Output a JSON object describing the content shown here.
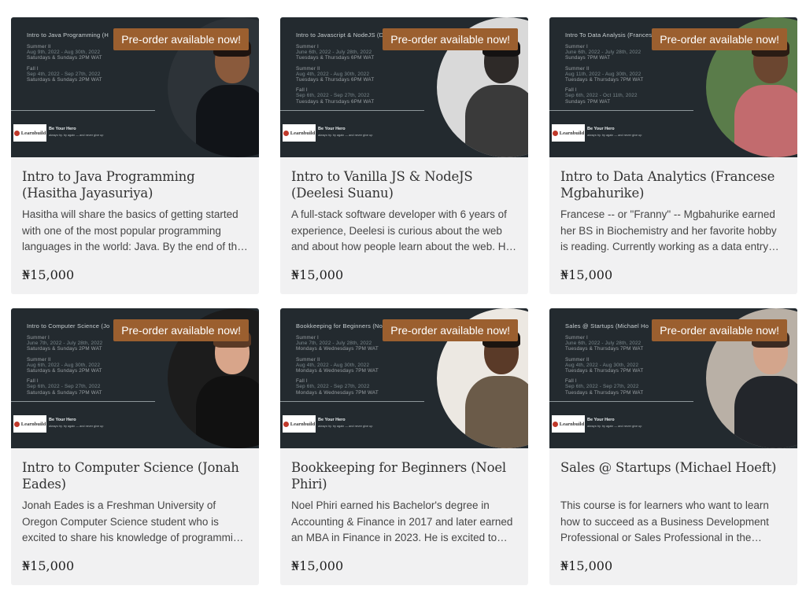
{
  "badge_label": "Pre-order available now!",
  "logo_text": "Learnbuild",
  "slogan": "Be Your Hero",
  "slogan_sub": "always try. try again — and never give up",
  "cards": [
    {
      "thumb_title": "Intro to Java Programming (H",
      "schedule": [
        [
          "Summer II",
          "Aug 9th, 2022 - Aug 30th, 2022",
          "Saturdays & Sundays 2PM WAT"
        ],
        [
          "Fall I",
          "Sep 4th, 2022 - Sep 27th, 2022",
          "Saturdays & Sundays 2PM WAT"
        ]
      ],
      "title": "Intro to Java Programming (Hasitha Jayasuriya)",
      "description": "Hasitha will share the basics of getting started with one of the most popular programming languages in the world: Java. By the end of this course you will be able to build simple applications.",
      "price": "₦15,000",
      "photo_bg": "#2d3338",
      "skin": "#8a5a3c",
      "hair": "#1e1410",
      "clothes": "#111418",
      "accent": "#b0222a"
    },
    {
      "thumb_title": "Intro to Javascript & NodeJS (De",
      "schedule": [
        [
          "Summer I",
          "June 6th, 2022 - July 28th, 2022",
          "Tuesdays & Thursdays 6PM WAT"
        ],
        [
          "Summer II",
          "Aug 4th, 2022 - Aug 30th, 2022",
          "Tuesdays & Thursdays 6PM WAT"
        ],
        [
          "Fall I",
          "Sep 6th, 2022 - Sep 27th, 2022",
          "Tuesdays & Thursdays 6PM WAT"
        ]
      ],
      "title": "Intro to Vanilla JS & NodeJS (Deelesi Suanu)",
      "description": "A full-stack software developer with 6 years of experience, Deelesi is curious about the web and about how people learn about the web. He will guide you through the building blocks of JavaScript.",
      "price": "₦15,000",
      "photo_bg": "#d9d9d9",
      "skin": "#2e2a28",
      "hair": "#141212",
      "clothes": "#3a3a3a",
      "accent": "#3a3a3a"
    },
    {
      "thumb_title": "Intro To Data Analysis (Francese",
      "schedule": [
        [
          "Summer I",
          "June 6th, 2022 - July 28th, 2022",
          "Sundays 7PM WAT"
        ],
        [
          "Summer II",
          "Aug 11th, 2022 - Aug 30th, 2022",
          "Tuesdays & Thursdays 7PM WAT"
        ],
        [
          "Fall I",
          "Sep 6th, 2022 - Oct 11th, 2022",
          "Sundays 7PM WAT"
        ]
      ],
      "title": "Intro to Data Analytics (Francese Mgbahurike)",
      "description": "Francese -- or \"Franny\" -- Mgbahurike earned her BS in Biochemistry and her favorite hobby is reading. Currently working as a data entry analyst, she loves teaching beginners.",
      "price": "₦15,000",
      "photo_bg": "#5a7c4a",
      "skin": "#6b4630",
      "hair": "#2a1c14",
      "clothes": "#c26b6e",
      "accent": "#8e4f7a"
    },
    {
      "thumb_title": "Intro to Computer Science (Jo",
      "schedule": [
        [
          "Summer I",
          "June 7th, 2022 - July 28th, 2022",
          "Saturdays & Sundays 2PM WAT"
        ],
        [
          "Summer II",
          "Aug 6th, 2022 - Aug 30th, 2022",
          "Saturdays & Sundays 2PM WAT"
        ],
        [
          "Fall I",
          "Sep 6th, 2022 - Sep 27th, 2022",
          "Saturdays & Sundays 7PM WAT"
        ]
      ],
      "title": "Intro to Computer Science (Jonah Eades)",
      "description": "Jonah Eades is a Freshman University of Oregon Computer Science student who is excited to share his knowledge of programming fundamentals with new learners.",
      "price": "₦15,000",
      "photo_bg": "#1c1c1c",
      "skin": "#d8a58a",
      "hair": "#5a3a26",
      "clothes": "#111111",
      "accent": "#b42a2a"
    },
    {
      "thumb_title": "Bookkeeping for Beginners (No",
      "schedule": [
        [
          "Summer I",
          "June 7th, 2022 - July 28th, 2022",
          "Mondays & Wednesdays 7PM WAT"
        ],
        [
          "Summer II",
          "Aug 4th, 2022 - Aug 30th, 2022",
          "Mondays & Wednesdays 7PM WAT"
        ],
        [
          "Fall I",
          "Sep 6th, 2022 - Sep 27th, 2022",
          "Mondays & Wednesdays 7PM WAT"
        ]
      ],
      "title": "Bookkeeping for Beginners (Noel Phiri)",
      "description": "Noel Phiri earned his Bachelor's degree in Accounting & Finance in 2017 and later earned an MBA in Finance in 2023. He is excited to teach the fundamentals of bookkeeping.",
      "price": "₦15,000",
      "photo_bg": "#ece8e2",
      "skin": "#5a3a28",
      "hair": "#1a1410",
      "clothes": "#6b5b49",
      "accent": "#7a6a58"
    },
    {
      "thumb_title": "Sales @ Startups (Michael Ho",
      "schedule": [
        [
          "Summer I",
          "June 6th, 2022 - July 28th, 2022",
          "Tuesdays & Thursdays 7PM WAT"
        ],
        [
          "Summer II",
          "Aug 4th, 2022 - Aug 30th, 2022",
          "Tuesdays & Thursdays 7PM WAT"
        ],
        [
          "Fall I",
          "Sep 6th, 2022 - Sep 27th, 2022",
          "Tuesdays & Thursdays 7PM WAT"
        ]
      ],
      "title": "Sales @ Startups (Michael Hoeft)",
      "description": "This course is for learners who want to learn how to succeed as a Business Development Professional or Sales Professional in the technology startup space.",
      "price": "₦15,000",
      "photo_bg": "#b9b0a6",
      "skin": "#d3a58c",
      "hair": "#3a2a22",
      "clothes": "#23262b",
      "accent": "#f2f2f2"
    }
  ]
}
